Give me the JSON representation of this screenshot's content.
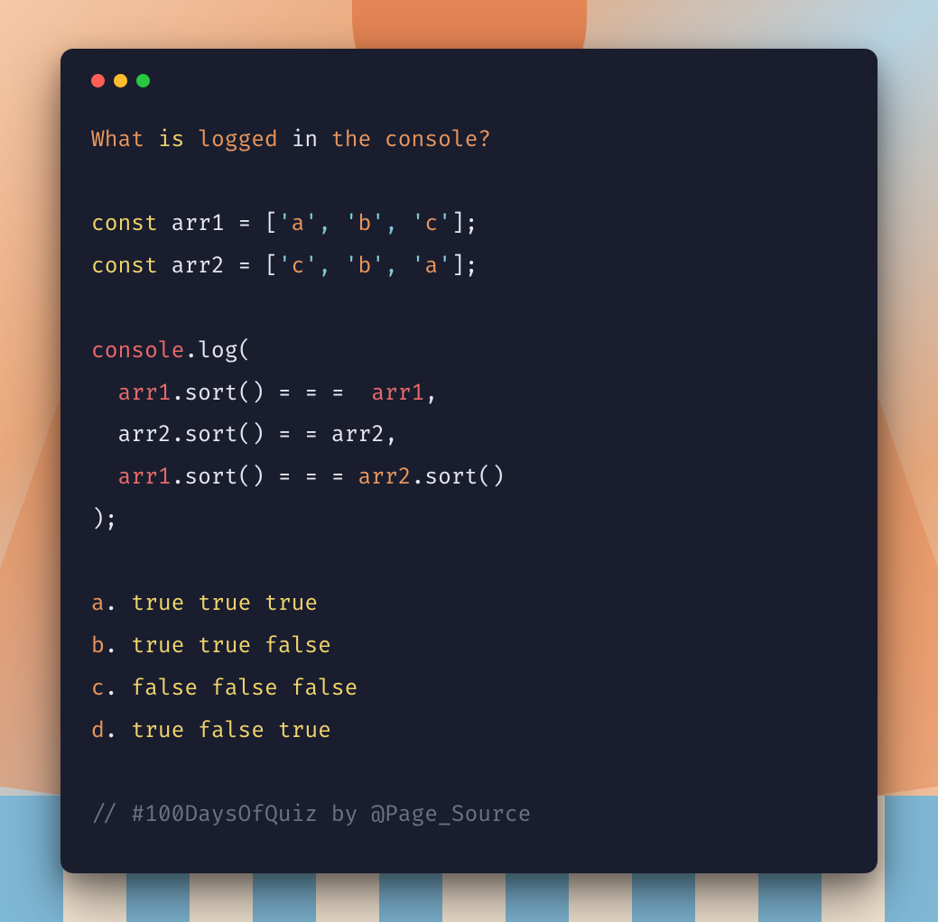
{
  "question": {
    "w1": "What",
    "w2": "is",
    "w3": "logged",
    "w4": "in",
    "w5": "the",
    "w6": "console",
    "qmark": "?"
  },
  "code": {
    "const": "const",
    "arr1": "arr1",
    "arr2": "arr2",
    "eq": "=",
    "lbrack": "[",
    "rbrack": "]",
    "semi": ";",
    "quote": "'",
    "a": "a",
    "b": "b",
    "c": "c",
    "comma": ",",
    "console": "console",
    "dotlog": ".log",
    "dotsort": ".sort",
    "lparen": "(",
    "rparen": ")",
    "tripleEqSpaced1": "= = = ",
    "tripleEqSpaced2": "= =",
    "tripleEqSpaced3": "= = ="
  },
  "options": {
    "a": {
      "label": "a",
      "dot": ". ",
      "v1": "true",
      "v2": "true",
      "v3": "true"
    },
    "b": {
      "label": "b",
      "dot": ". ",
      "v1": "true",
      "v2": "true",
      "v3": "false"
    },
    "c": {
      "label": "c",
      "dot": ". ",
      "v1": "false",
      "v2": "false",
      "v3": "false"
    },
    "d": {
      "label": "d",
      "dot": ". ",
      "v1": "true",
      "v2": "false",
      "v3": "true"
    }
  },
  "comment": "// #100DaysOfQuiz by @Page_Source"
}
